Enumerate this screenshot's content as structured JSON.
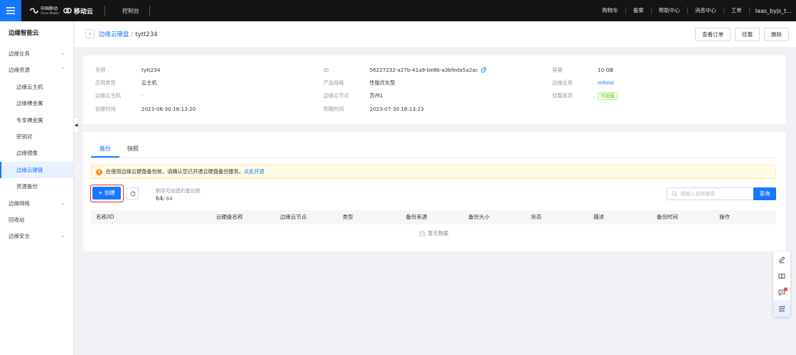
{
  "topbar": {
    "logo_cm_cn": "中国移动",
    "logo_cm_en": "China Mobile",
    "logo_yd": "移动云",
    "console": "控制台",
    "nav": [
      "购物车",
      "备案",
      "帮助中心",
      "消息中心",
      "工单"
    ],
    "user": "Iaas_byjs_t..."
  },
  "sidebar": {
    "title": "边缘智能云",
    "items": [
      {
        "label": "边缘业务",
        "level": 1,
        "chevron": "down"
      },
      {
        "label": "边缘资源",
        "level": 1,
        "chevron": "up"
      },
      {
        "label": "边缘云主机",
        "level": 2
      },
      {
        "label": "边缘裸金属",
        "level": 2
      },
      {
        "label": "专享裸金属",
        "level": 2
      },
      {
        "label": "密钥对",
        "level": 2
      },
      {
        "label": "边缘镜像",
        "level": 2
      },
      {
        "label": "边缘云硬盘",
        "level": 2,
        "active": true
      },
      {
        "label": "资源备份",
        "level": 2
      },
      {
        "label": "边缘网络",
        "level": 1,
        "chevron": "down"
      },
      {
        "label": "回收站",
        "level": 1
      },
      {
        "label": "边缘安全",
        "level": 1,
        "chevron": "down"
      }
    ]
  },
  "header": {
    "crumb_parent": "边缘云硬盘",
    "crumb_sep": "/",
    "crumb_current": "tytt234",
    "actions": [
      "查看订单",
      "挂载",
      "删除"
    ]
  },
  "info": {
    "rows": [
      [
        {
          "label": "名称",
          "value": "tytt234"
        },
        {
          "label": "ID",
          "value": "56227232-a27b-41a9-be8b-a3bfeda5a2ac",
          "copy": true
        },
        {
          "label": "容量",
          "value": "10 GB"
        }
      ],
      [
        {
          "label": "应用类型",
          "value": "云主机"
        },
        {
          "label": "产品规格",
          "value": "性能优化型"
        },
        {
          "label": "边缘业务",
          "value": "mltest",
          "link": true
        }
      ],
      [
        {
          "label": "边缘云主机",
          "value": "-"
        },
        {
          "label": "边缘云节点",
          "value": "苏州1"
        },
        {
          "label": "挂载状态",
          "value": "可挂载",
          "tag": true
        }
      ],
      [
        {
          "label": "创建时间",
          "value": "2023-06-30 18:13:20"
        },
        {
          "label": "到期时间",
          "value": "2023-07-30 18:13:23"
        }
      ]
    ]
  },
  "backup": {
    "tabs": [
      "备份",
      "快照"
    ],
    "notice_text": "在使用边缘云硬盘备份前，请确认您已开通云硬盘备份服务。",
    "notice_link": "点此开通",
    "create_label": "+ 创建",
    "quota_label": "剩余可创建的备份数",
    "quota_remaining": "64",
    "quota_total": "/ 64",
    "search_placeholder": "请输入名称搜索",
    "search_button": "查询",
    "columns": [
      "名称/ID",
      "云硬盘名称",
      "边缘云节点",
      "类型",
      "备份来源",
      "备份大小",
      "状态",
      "描述",
      "备份时间",
      "操作"
    ],
    "empty_text": "暂无数据"
  },
  "floatbar": {
    "icons": [
      "edit-icon",
      "book-icon",
      "message-icon",
      "list-icon"
    ]
  },
  "colors": {
    "primary": "#1677ff",
    "topbar_bg": "#141414",
    "highlight_border": "#e02a2a",
    "success": "#52c41a"
  }
}
